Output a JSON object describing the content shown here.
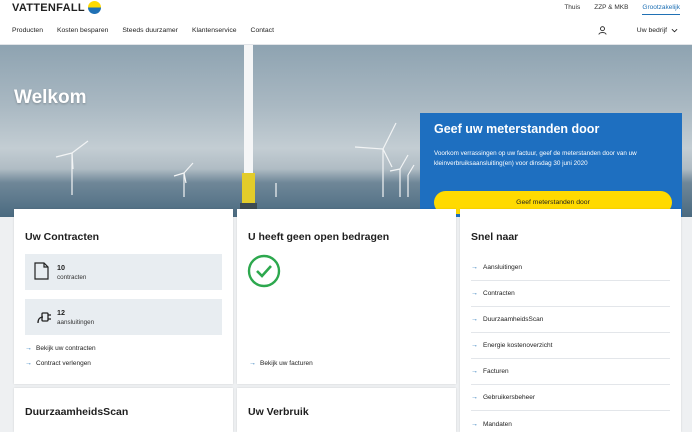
{
  "header": {
    "logo_text": "VATTENFALL",
    "segments": [
      "Thuis",
      "ZZP & MKB",
      "Grootzakelijk"
    ],
    "active_segment": 2,
    "nav": [
      "Producten",
      "Kosten besparen",
      "Steeds duurzamer",
      "Klantenservice",
      "Contact"
    ],
    "company_label": "Uw bedrijf"
  },
  "hero": {
    "welcome": "Welkom",
    "promo": {
      "title": "Geef uw meterstanden door",
      "text": "Voorkom verrassingen op uw factuur, geef de meterstanden door van uw kleinverbruiksaansluiting(en) voor dinsdag 30 juni 2020",
      "button": "Geef meterstanden door",
      "slides_total": 3,
      "slide_active": 2
    }
  },
  "contracts": {
    "title": "Uw Contracten",
    "stats": [
      {
        "number": "10",
        "label": "contracten",
        "icon": "document-icon"
      },
      {
        "number": "12",
        "label": "aansluitingen",
        "icon": "plug-icon"
      }
    ],
    "links": [
      "Bekijk uw contracten",
      "Contract verlengen"
    ]
  },
  "payments": {
    "title": "U heeft geen open bedragen",
    "link": "Bekijk uw facturen"
  },
  "quicklinks": {
    "title": "Snel naar",
    "items": [
      "Aansluitingen",
      "Contracten",
      "DuurzaamheidsScan",
      "Energie kostenoverzicht",
      "Facturen",
      "Gebruikersbeheer",
      "Mandaten"
    ]
  },
  "bottom_cards": {
    "scan_title": "DuurzaamheidsScan",
    "usage_title": "Uw Verbruik"
  },
  "colors": {
    "brand_blue": "#1e6fc0",
    "brand_yellow": "#ffda00",
    "success_green": "#2da84e"
  }
}
